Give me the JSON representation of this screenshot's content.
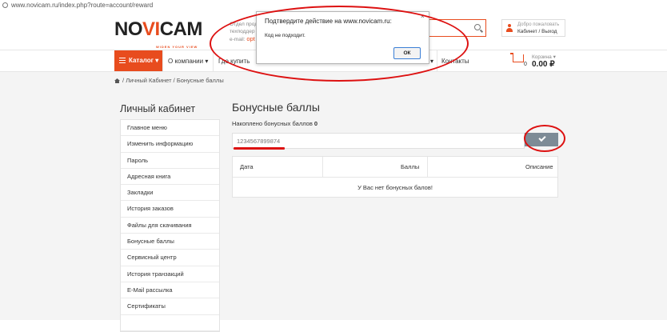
{
  "browser": {
    "url": "www.novicam.ru/index.php?route=account/reward"
  },
  "header": {
    "logo_text": "NOVICAM",
    "logo_tagline": "WIDEN YOUR VIEW",
    "info_line1": "Отдел прод",
    "info_line2": "техподдер",
    "info_line3_prefix": "e-mail:",
    "info_line3_value": "opt",
    "account_greeting": "Добро пожаловать",
    "account_links": "Кабинет / Выход"
  },
  "nav": {
    "catalog_label": "Каталог",
    "items": [
      "О компании",
      "Где купить",
      "Контакты"
    ],
    "cart": {
      "label": "Корзина",
      "count": "0",
      "total": "0.00 ₽"
    }
  },
  "breadcrumb": {
    "items": [
      "Личный Кабинет",
      "Бонусные баллы"
    ],
    "separator": "/"
  },
  "sidebar": {
    "title": "Личный кабинет",
    "items": [
      "Главное меню",
      "Изменить информацию",
      "Пароль",
      "Адресная книга",
      "Закладки",
      "История заказов",
      "Файлы для скачивания",
      "Бонусные баллы",
      "Сервисный центр",
      "История транзакций",
      "E-Mail рассылка",
      "Сертификаты"
    ]
  },
  "main": {
    "title": "Бонусные баллы",
    "accumulated_label": "Накоплено бонусных баллов",
    "accumulated_value": "0",
    "code_input_value": "1234567899874",
    "table": {
      "columns": [
        "Дата",
        "Баллы",
        "Описание"
      ],
      "empty_text": "У Вас нет бонусных балов!"
    }
  },
  "dialog": {
    "title": "Подтвердите действие на www.novicam.ru:",
    "message": "Код не подходит.",
    "ok_label": "ОК",
    "close_symbol": "×"
  },
  "colors": {
    "accent": "#e84c1e",
    "annotation": "#dd1111",
    "button": "#7d8b96"
  }
}
